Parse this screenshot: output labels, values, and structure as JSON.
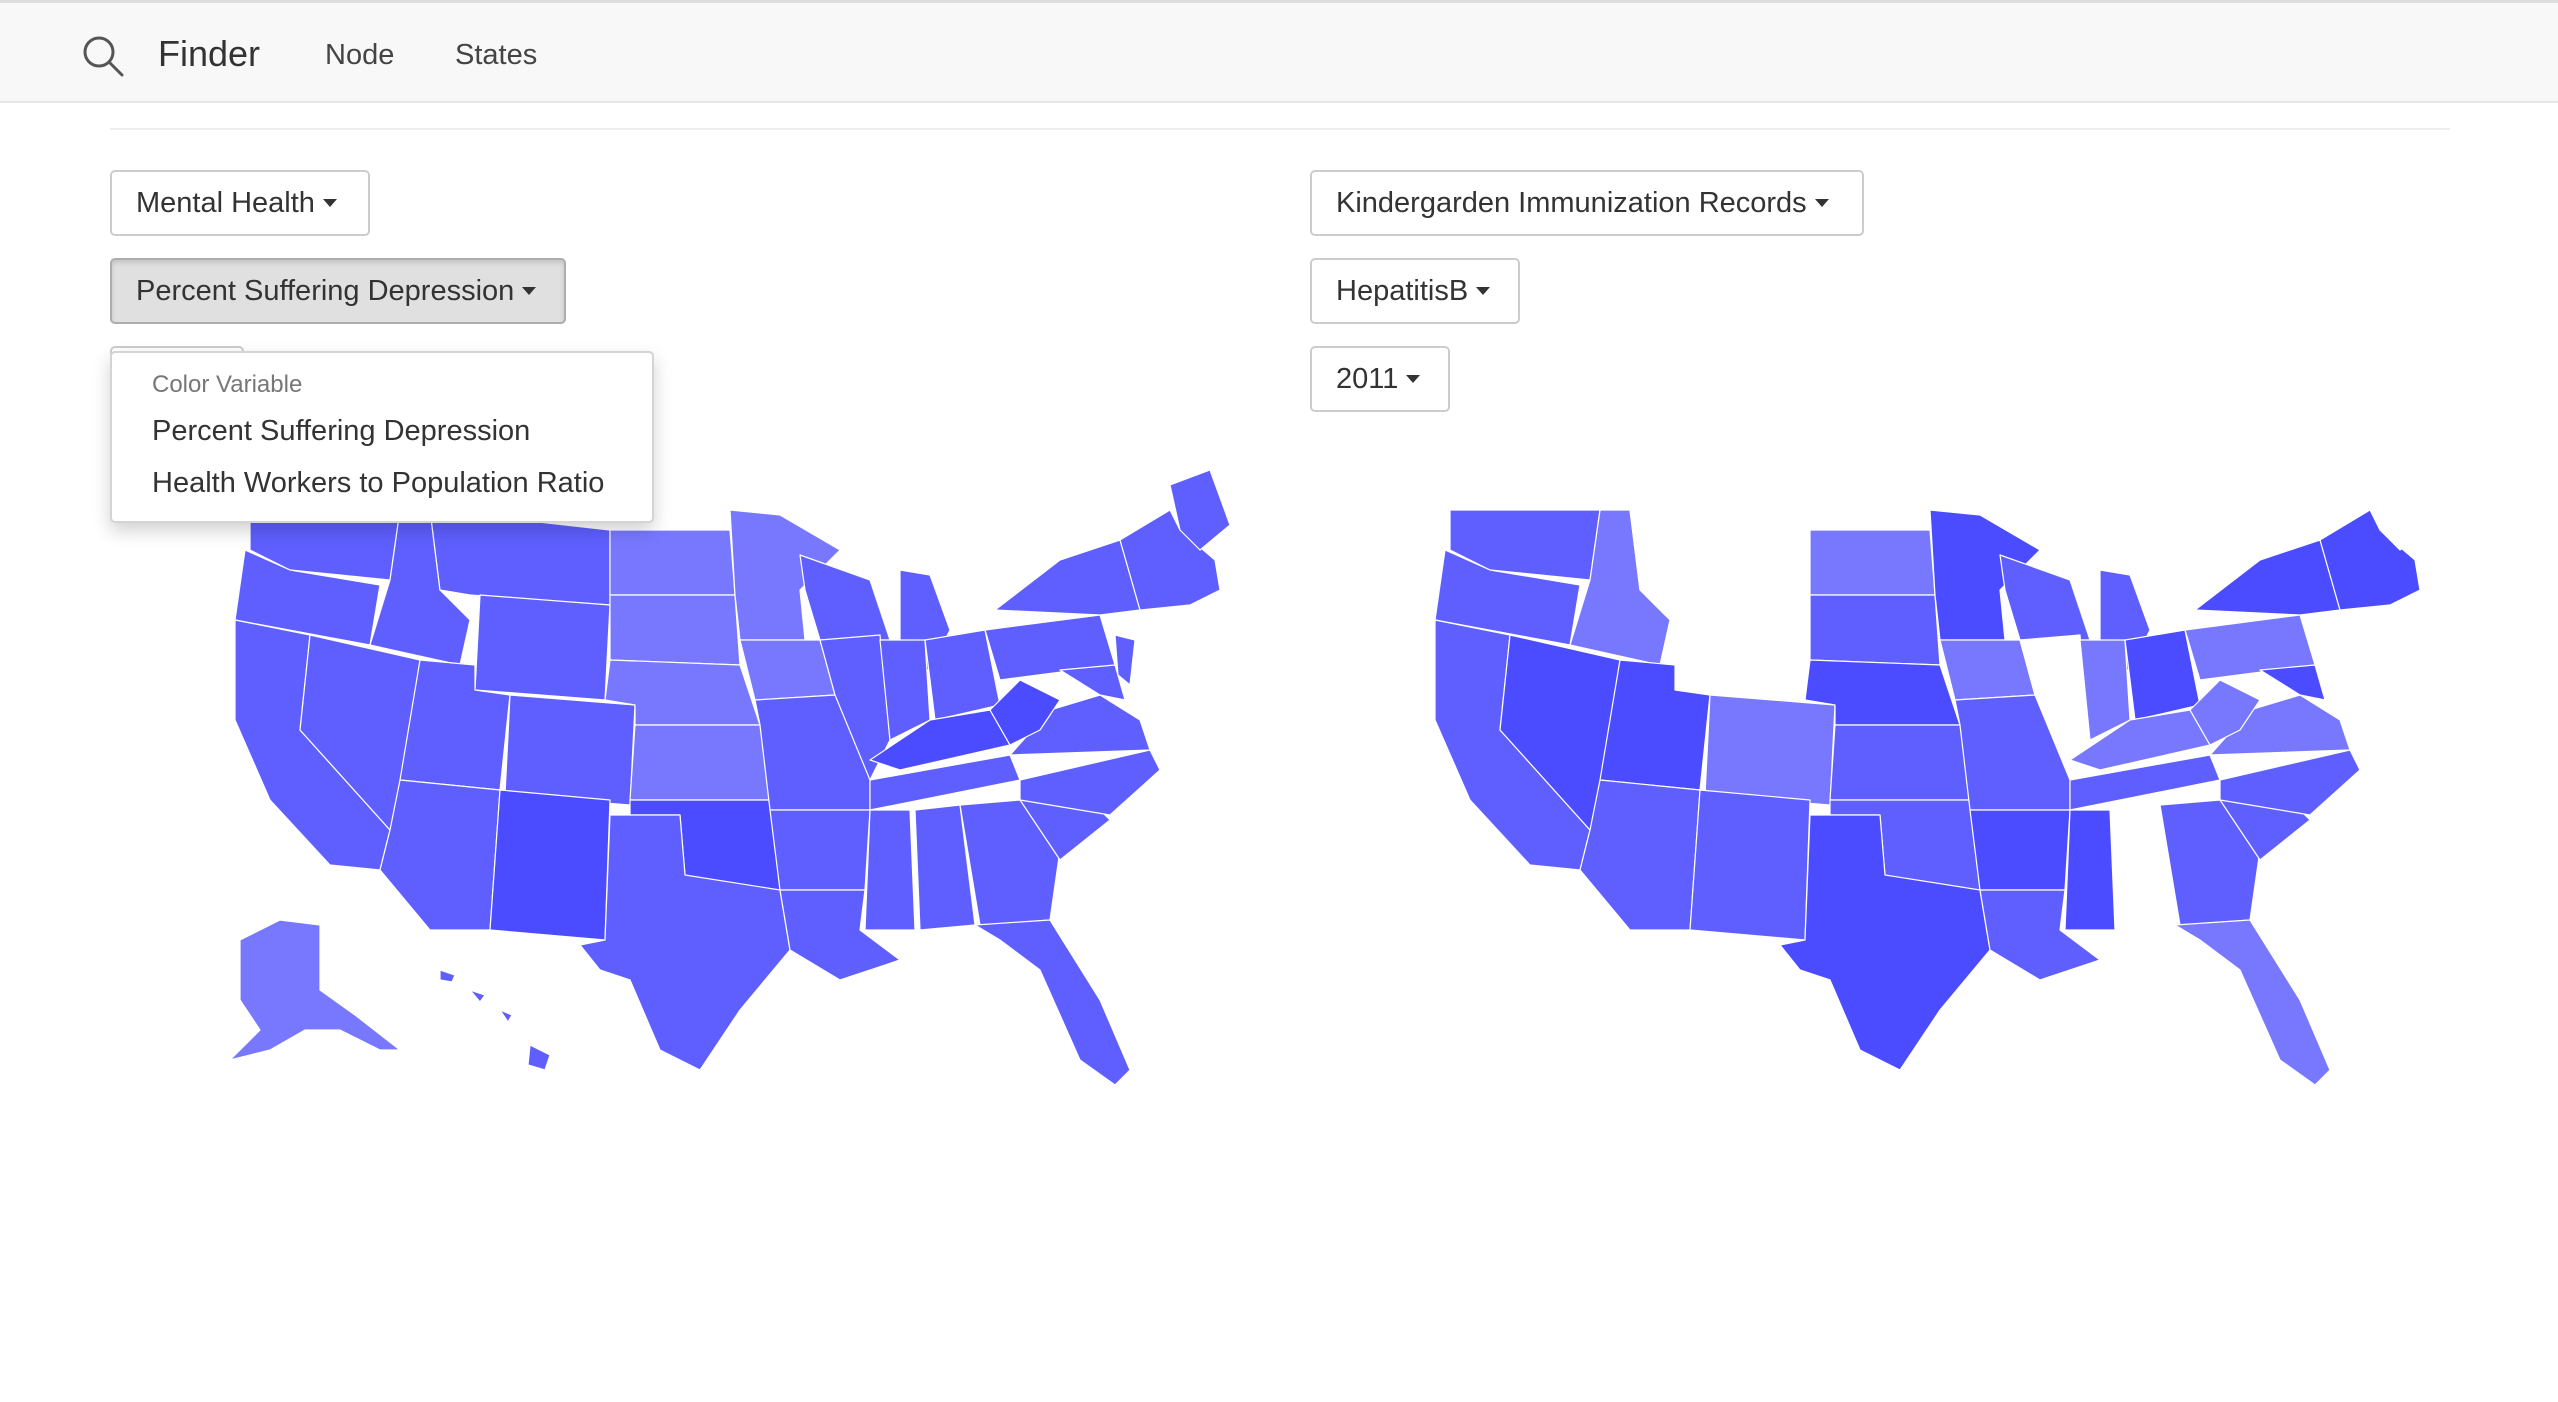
{
  "nav": {
    "brand": "Finder",
    "links": [
      "Node",
      "States"
    ]
  },
  "left_panel": {
    "category": "Mental Health",
    "variable": "Percent Suffering Depression",
    "menu": {
      "header": "Color Variable",
      "items": [
        "Percent Suffering Depression",
        "Health Workers to Population Ratio"
      ]
    }
  },
  "right_panel": {
    "category": "Kindergarden Immunization Records",
    "variable": "HepatitisB",
    "year": "2011"
  },
  "colors": {
    "fill_dark": "#4b4bff",
    "fill_mid": "#5f5fff",
    "fill_light": "#7878ff",
    "no_data": "#ffffff"
  }
}
